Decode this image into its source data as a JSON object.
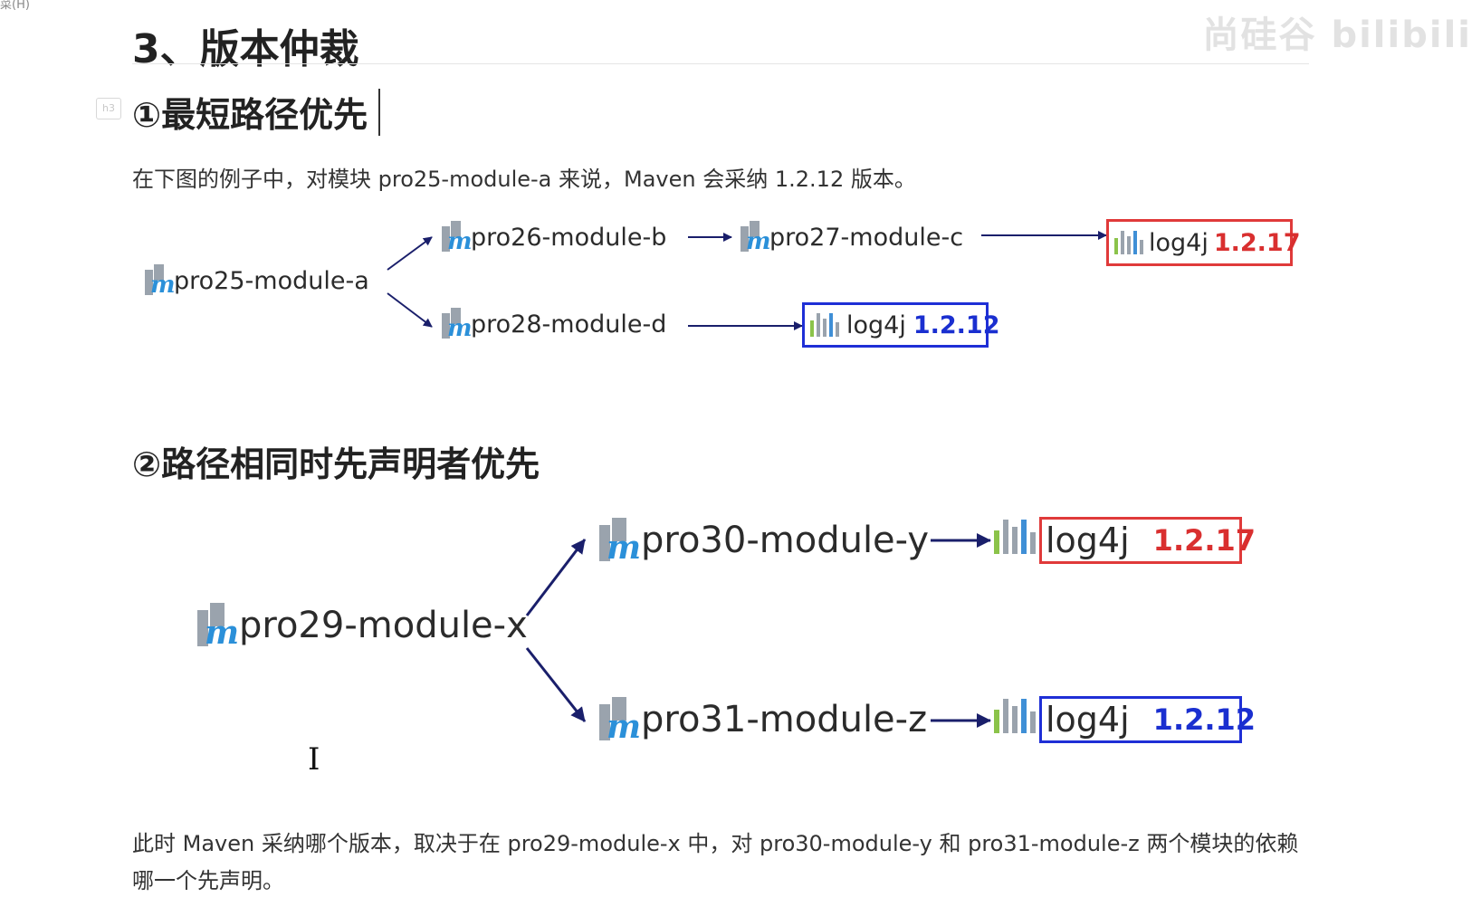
{
  "header": {
    "corner_fragment": "菜(H)",
    "watermark": "尚硅谷 bilibili"
  },
  "doc": {
    "title": "3、版本仲裁",
    "heading_tag": "h3",
    "section1": {
      "heading": "①最短路径优先",
      "text": "在下图的例子中，对模块 pro25-module-a 来说，Maven 会采纳 1.2.12 版本。",
      "diagram": {
        "root": "pro25-module-a",
        "b": "pro26-module-b",
        "c": "pro27-module-c",
        "d": "pro28-module-d",
        "lib_top": {
          "name": "log4j",
          "version": "1.2.17"
        },
        "lib_bottom": {
          "name": "log4j",
          "version": "1.2.12"
        }
      }
    },
    "section2": {
      "heading": "②路径相同时先声明者优先",
      "diagram": {
        "root": "pro29-module-x",
        "y": "pro30-module-y",
        "z": "pro31-module-z",
        "lib_top": {
          "name": "log4j",
          "version": "1.2.17"
        },
        "lib_bottom": {
          "name": "log4j",
          "version": "1.2.12"
        }
      },
      "text": "此时 Maven 采纳哪个版本，取决于在 pro29-module-x 中，对 pro30-module-y 和 pro31-module-z 两个模块的依赖哪一个先声明。"
    }
  },
  "colors": {
    "accent_red": "#d92f2f",
    "accent_blue": "#1a2fd0",
    "arrow": "#1a1f6b",
    "maven_m": "#2b90d9"
  },
  "icons": {
    "module": "maven-module-icon",
    "library": "library-bars-icon",
    "cursor": "text-cursor-icon"
  }
}
